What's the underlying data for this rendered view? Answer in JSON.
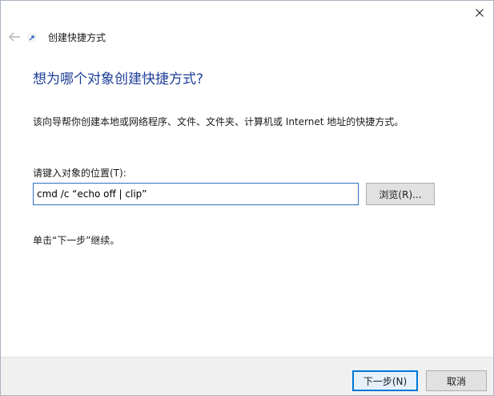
{
  "wizard": {
    "title": "创建快捷方式"
  },
  "page": {
    "heading": "想为哪个对象创建快捷方式?",
    "description": "该向导帮你创建本地或网络程序、文件、文件夹、计算机或 Internet 地址的快捷方式。",
    "field_label": "请键入对象的位置(T):",
    "location_value": "cmd /c “echo off | clip”",
    "browse_label": "浏览(R)...",
    "hint": "单击“下一步”继续。"
  },
  "footer": {
    "next_label": "下一步(N)",
    "cancel_label": "取消"
  },
  "icons": {
    "close": "close-icon",
    "back": "back-arrow-icon",
    "wizard": "shortcut-icon"
  },
  "colors": {
    "heading": "#1f3f99",
    "focus_border": "#2d72c4",
    "default_button_border": "#0078d7"
  }
}
